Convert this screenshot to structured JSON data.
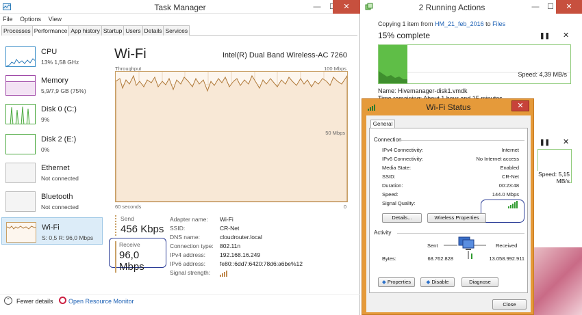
{
  "task_manager": {
    "title": "Task Manager",
    "window_controls": [
      "—",
      "☐",
      "✕"
    ],
    "menu": [
      "File",
      "Options",
      "View"
    ],
    "tabs": [
      "Processes",
      "Performance",
      "App history",
      "Startup",
      "Users",
      "Details",
      "Services"
    ],
    "active_tab": "Performance",
    "sidebar": [
      {
        "name": "CPU",
        "value": "13% 1,58 GHz"
      },
      {
        "name": "Memory",
        "value": "5,9/7,9 GB (75%)"
      },
      {
        "name": "Disk 0 (C:)",
        "value": "9%"
      },
      {
        "name": "Disk 2 (E:)",
        "value": "0%"
      },
      {
        "name": "Ethernet",
        "value": "Not connected"
      },
      {
        "name": "Bluetooth",
        "value": "Not connected"
      },
      {
        "name": "Wi-Fi",
        "value": "S: 0,5 R: 96,0 Mbps"
      }
    ],
    "main": {
      "heading": "Wi-Fi",
      "adapter": "Intel(R) Dual Band Wireless-AC 7260",
      "graph_label": "Throughput",
      "graph_max": "100 Mbps",
      "graph_mid": "50 Mbps",
      "graph_time": "60 seconds",
      "graph_zero": "0",
      "send_label": "Send",
      "send_value": "456 Kbps",
      "receive_label": "Receive",
      "receive_value": "96,0 Mbps",
      "details": [
        {
          "key": "Adapter name:",
          "value": "Wi-Fi"
        },
        {
          "key": "SSID:",
          "value": "CR-Net"
        },
        {
          "key": "DNS name:",
          "value": "cloudrouter.local"
        },
        {
          "key": "Connection type:",
          "value": "802.11n"
        },
        {
          "key": "IPv4 address:",
          "value": "192.168.16.249"
        },
        {
          "key": "IPv6 address:",
          "value": "fe80::6dd7:6420:78d6:a6be%12"
        },
        {
          "key": "Signal strength:",
          "value": ""
        }
      ]
    },
    "footer": {
      "fewer_details": "Fewer details",
      "open_monitor": "Open Resource Monitor"
    }
  },
  "running_actions": {
    "title": "2 Running Actions",
    "copy_prefix": "Copying 1 item from ",
    "copy_source": "HM_21_feb_2016",
    "copy_to": " to ",
    "copy_dest": "Files",
    "percent": "15% complete",
    "percent_value": 15,
    "speed1": "Speed: 4,39 MB/s",
    "name_line": "Name: Hivemanager-disk1.vmdk",
    "time_line": "Time remaining: About 1 hour and 15 minutes",
    "speed2": "Speed: 5,15 MB/s",
    "pause_glyph": "❚❚",
    "close_glyph": "✕"
  },
  "wifi_status": {
    "title": "Wi-Fi Status",
    "tab": "General",
    "connection_label": "Connection",
    "rows": [
      {
        "key": "IPv4 Connectivity:",
        "value": "Internet"
      },
      {
        "key": "IPv6 Connectivity:",
        "value": "No Internet access"
      },
      {
        "key": "Media State:",
        "value": "Enabled"
      },
      {
        "key": "SSID:",
        "value": "CR-Net"
      },
      {
        "key": "Duration:",
        "value": "00:23:48"
      },
      {
        "key": "Speed:",
        "value": "144.0 Mbps"
      },
      {
        "key": "Signal Quality:",
        "value": ""
      }
    ],
    "details_button": "Details...",
    "wireless_button": "Wireless Properties",
    "activity_label": "Activity",
    "sent_label": "Sent",
    "received_label": "Received",
    "bytes_label": "Bytes:",
    "bytes_sent": "68.762.828",
    "bytes_received": "13.058.992.911",
    "properties_button": "Properties",
    "disable_button": "Disable",
    "diagnose_button": "Diagnose",
    "close_button": "Close"
  }
}
